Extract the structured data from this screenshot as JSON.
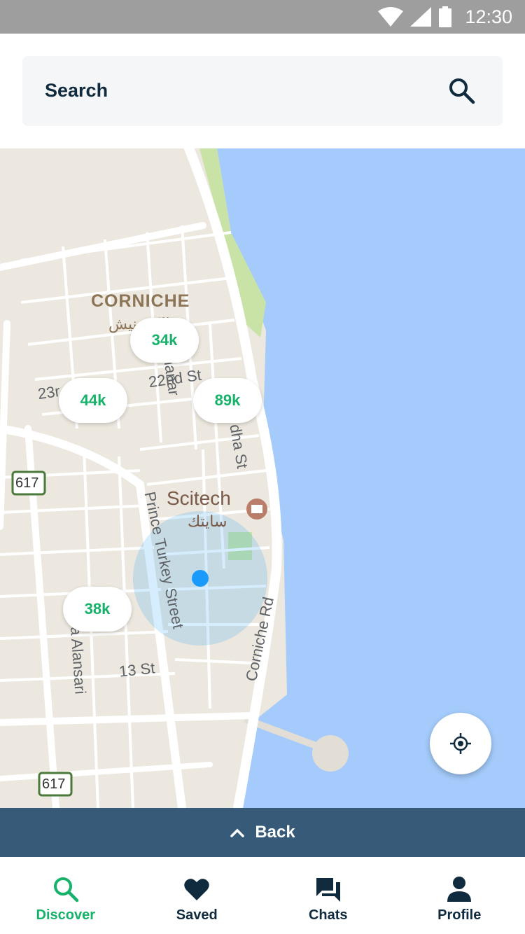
{
  "status_bar": {
    "time": "12:30",
    "icons": [
      "wifi-icon",
      "signal-icon",
      "battery-icon"
    ]
  },
  "search": {
    "label": "Search",
    "icon": "search-icon"
  },
  "map": {
    "labels": {
      "district": "CORNICHE",
      "district_ar": "الكورنيش",
      "poi": "Scitech",
      "poi_ar": "سايتك",
      "street_almanar": "Almanar",
      "street_22nd": "22nd St",
      "street_23rd": "23r",
      "street_rodha": "dha St",
      "street_prince_turkey": "Prince Turkey Street",
      "street_corniche": "Corniche Rd",
      "street_13": "13 St",
      "street_alansari": "ria Alansari",
      "route_617_a": "617",
      "route_617_b": "617"
    },
    "price_pins": [
      {
        "label": "34k"
      },
      {
        "label": "44k"
      },
      {
        "label": "89k"
      },
      {
        "label": "38k"
      }
    ]
  },
  "back_bar": {
    "label": "Back",
    "icon": "chevron-up-icon"
  },
  "bottom_nav": [
    {
      "label": "Discover",
      "icon": "search-icon",
      "active": true
    },
    {
      "label": "Saved",
      "icon": "heart-icon",
      "active": false
    },
    {
      "label": "Chats",
      "icon": "chat-icon",
      "active": false
    },
    {
      "label": "Profile",
      "icon": "person-icon",
      "active": false
    }
  ],
  "colors": {
    "accent": "#17b26a",
    "primary_text": "#0f2b3d",
    "water": "#a4cbfb",
    "land": "#ece8df",
    "park": "#c8e3a5",
    "back_bar": "#264c6e",
    "user_location": "#1a9bfc"
  }
}
